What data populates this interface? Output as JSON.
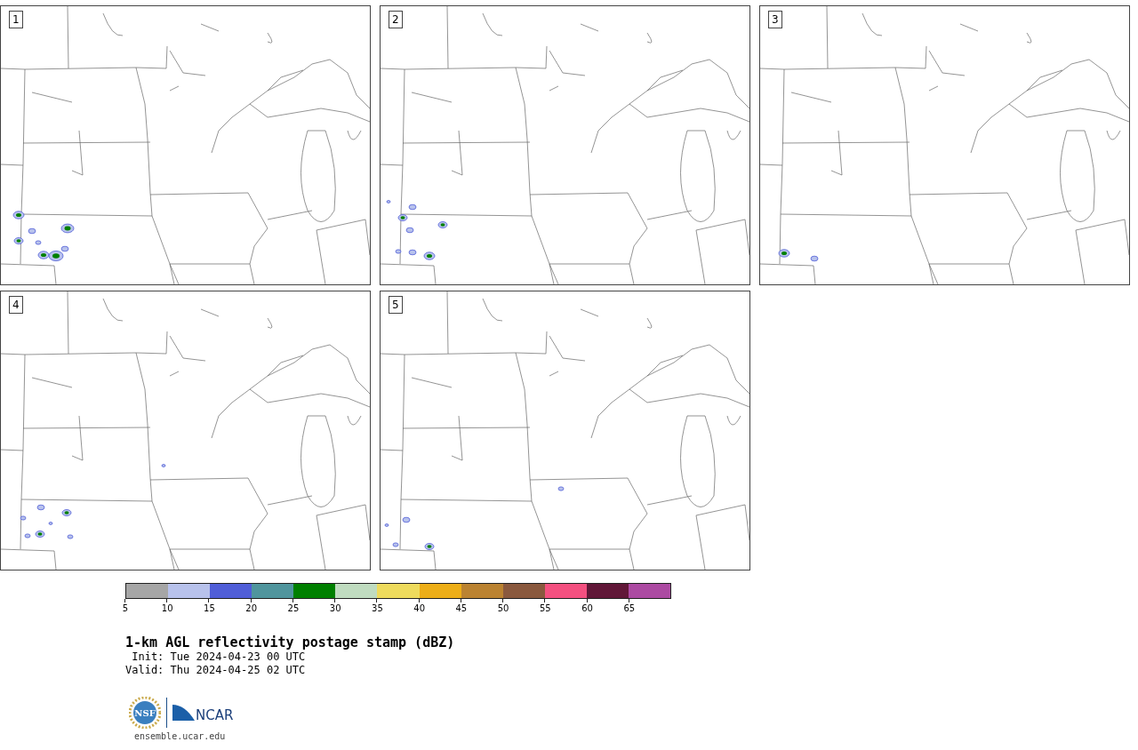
{
  "panels": [
    {
      "label": "1"
    },
    {
      "label": "2"
    },
    {
      "label": "3"
    },
    {
      "label": "4"
    },
    {
      "label": "5"
    }
  ],
  "colorbar": {
    "segments": [
      {
        "color": "#a6a6a6",
        "tick": "5"
      },
      {
        "color": "#b8c2ec",
        "tick": "10"
      },
      {
        "color": "#505ed8",
        "tick": "15"
      },
      {
        "color": "#50959d",
        "tick": "20"
      },
      {
        "color": "#008000",
        "tick": "25"
      },
      {
        "color": "#c0dcc0",
        "tick": "30"
      },
      {
        "color": "#eedb5d",
        "tick": "35"
      },
      {
        "color": "#edae18",
        "tick": "40"
      },
      {
        "color": "#bb8331",
        "tick": "45"
      },
      {
        "color": "#8a593e",
        "tick": "50"
      },
      {
        "color": "#f45080",
        "tick": "55"
      },
      {
        "color": "#611838",
        "tick": "60"
      },
      {
        "color": "#ac4aa2",
        "tick": "65"
      }
    ]
  },
  "title": "1-km AGL reflectivity postage stamp (dBZ)",
  "init": " Init: Tue 2024-04-23 00 UTC",
  "valid": "Valid: Thu 2024-04-25 02 UTC",
  "logos": {
    "left": "NSF",
    "right": "NCAR"
  },
  "footer": "ensemble.ucar.edu"
}
